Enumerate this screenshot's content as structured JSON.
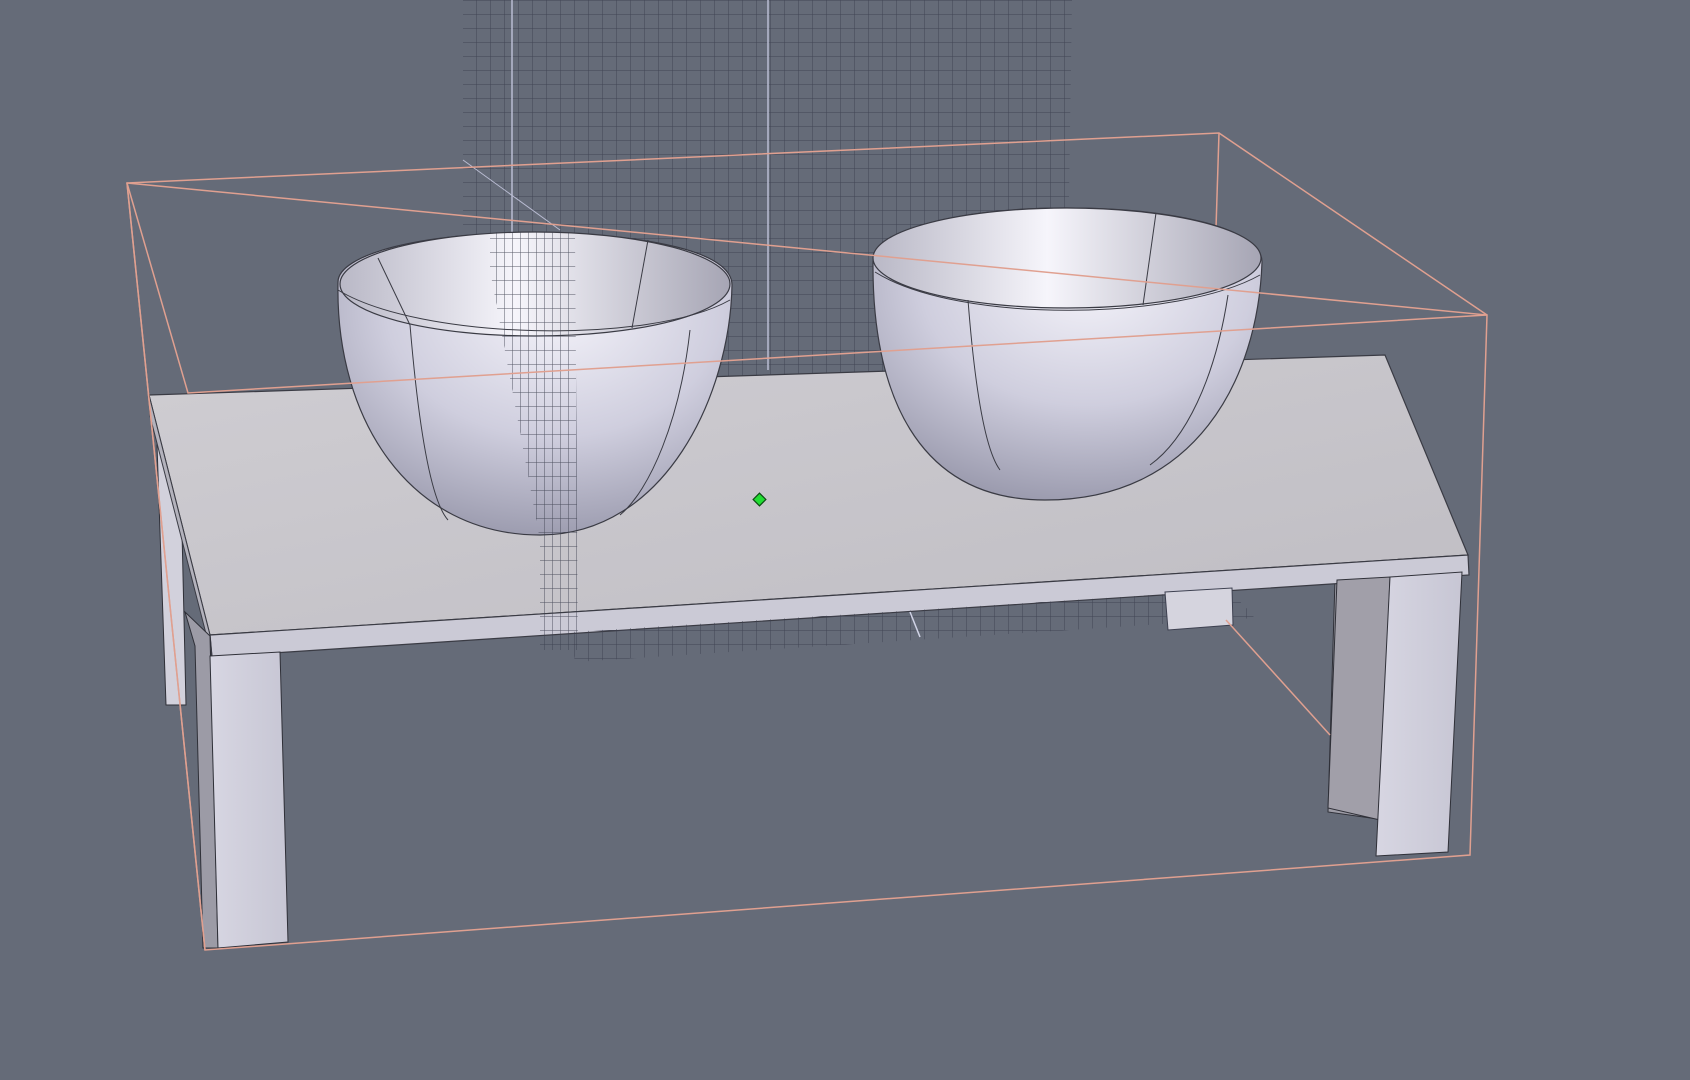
{
  "viewport": {
    "background_color": "#656b78",
    "view_mode": "3d-perspective",
    "shading": "smooth-with-edges"
  },
  "scene": {
    "objects": [
      {
        "name": "table",
        "kind": "box-table",
        "legs": 4,
        "color": "#cfcdd2"
      },
      {
        "name": "bowl-left",
        "kind": "hemisphere-bowl",
        "color": "#d9d8e4"
      },
      {
        "name": "bowl-right",
        "kind": "hemisphere-bowl",
        "color": "#d9d8e4"
      }
    ],
    "selection": {
      "bounding_box_color": "#e0a090",
      "selected": true
    },
    "construction_grids": {
      "color": "#3d4050",
      "visible": true
    },
    "pivot": {
      "color": "#22dd33",
      "visible": true
    }
  }
}
